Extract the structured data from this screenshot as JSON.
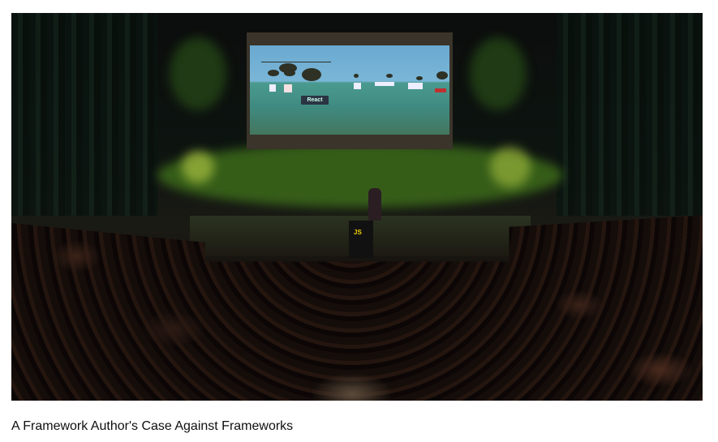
{
  "video": {
    "thumbnail": "conference-stage-photo",
    "slide_label": "React",
    "podium_logo": "JS"
  },
  "caption": "A Framework Author's Case Against Frameworks"
}
